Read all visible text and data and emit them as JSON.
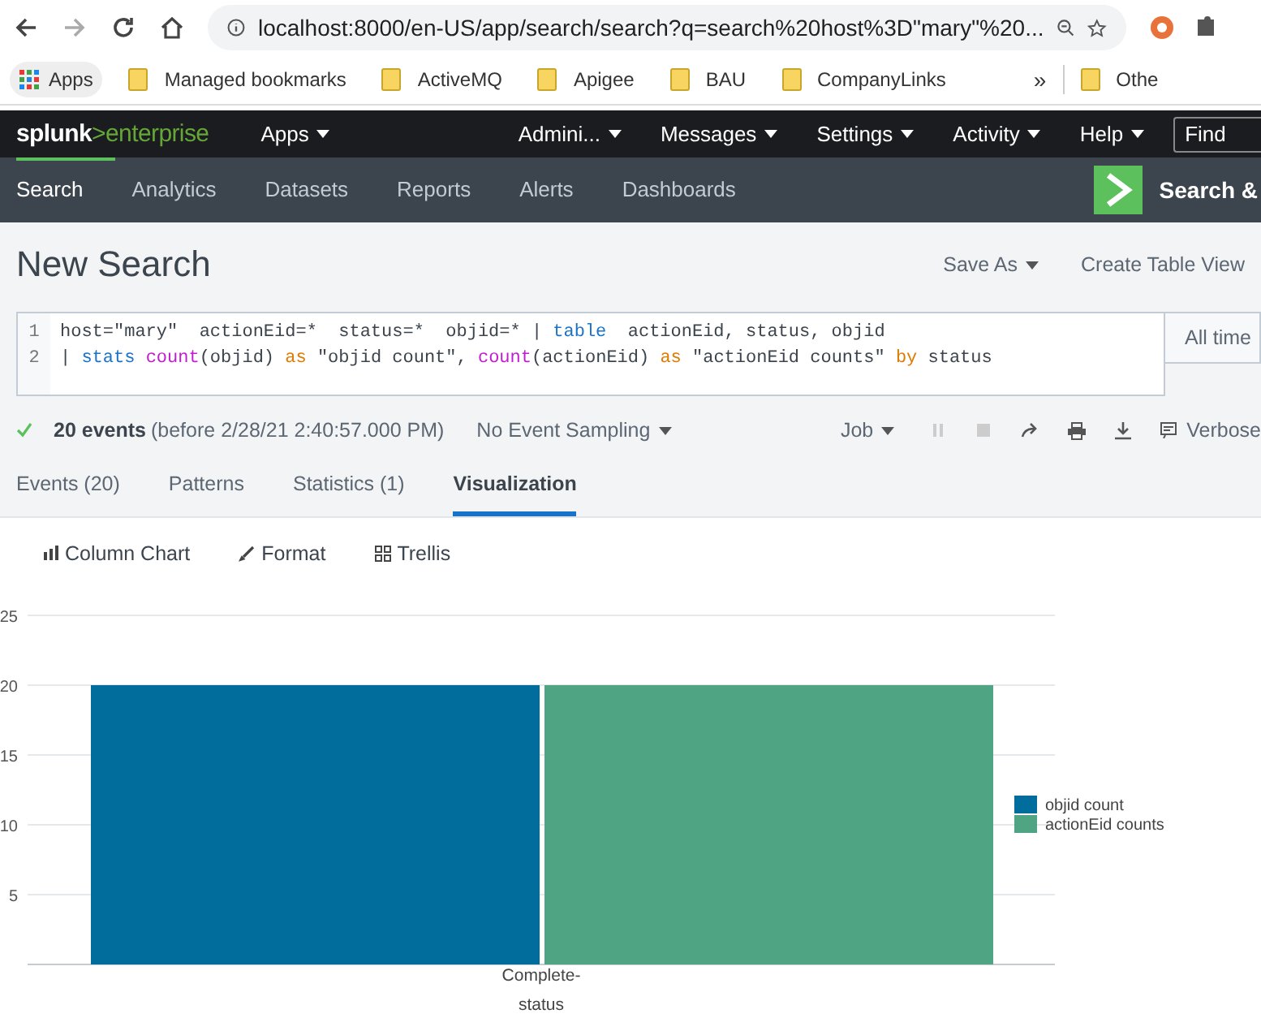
{
  "browser": {
    "url": "localhost:8000/en-US/app/search/search?q=search%20host%3D\"mary\"%20...",
    "apps_label": "Apps",
    "bookmarks": [
      "Managed bookmarks",
      "ActiveMQ",
      "Apigee",
      "BAU",
      "CompanyLinks"
    ],
    "overflow_chevron": "»",
    "other_bookmarks": "Othe"
  },
  "top_nav": {
    "logo_primary": "splunk",
    "logo_secondary": ">enterprise",
    "items": [
      {
        "label": "Apps",
        "kind": "menu"
      },
      {
        "label": "Admini...",
        "kind": "user"
      },
      {
        "label": "Messages",
        "kind": "menu"
      },
      {
        "label": "Settings",
        "kind": "menu"
      },
      {
        "label": "Activity",
        "kind": "menu"
      },
      {
        "label": "Help",
        "kind": "menu"
      }
    ],
    "find_placeholder": "Find"
  },
  "app_nav": {
    "items": [
      {
        "label": "Search",
        "selected": true
      },
      {
        "label": "Analytics",
        "selected": false
      },
      {
        "label": "Datasets",
        "selected": false
      },
      {
        "label": "Reports",
        "selected": false
      },
      {
        "label": "Alerts",
        "selected": false
      },
      {
        "label": "Dashboards",
        "selected": false
      }
    ],
    "app_title": "Search &"
  },
  "header": {
    "title": "New Search",
    "actions": [
      {
        "label": "Save As",
        "dropdown": true
      },
      {
        "label": "Create Table View",
        "dropdown": false
      }
    ]
  },
  "query": {
    "lines": [
      {
        "number": "1",
        "tokens": [
          {
            "text": "host=\"mary\"  actionEid=*  status=*  objid=* | ",
            "kind": "plain"
          },
          {
            "text": "table",
            "kind": "command"
          },
          {
            "text": "  actionEid, status, objid",
            "kind": "plain"
          }
        ]
      },
      {
        "number": "2",
        "tokens": [
          {
            "text": "| ",
            "kind": "plain"
          },
          {
            "text": "stats ",
            "kind": "command"
          },
          {
            "text": "count",
            "kind": "function"
          },
          {
            "text": "(objid) ",
            "kind": "plain"
          },
          {
            "text": "as",
            "kind": "keyword"
          },
          {
            "text": " \"objid count\", ",
            "kind": "plain"
          },
          {
            "text": "count",
            "kind": "function"
          },
          {
            "text": "(actionEid) ",
            "kind": "plain"
          },
          {
            "text": "as",
            "kind": "keyword"
          },
          {
            "text": " \"actionEid counts\" ",
            "kind": "plain"
          },
          {
            "text": "by",
            "kind": "keyword"
          },
          {
            "text": " status",
            "kind": "plain"
          }
        ]
      }
    ],
    "time_range": "All time"
  },
  "job": {
    "event_count": "20 events",
    "event_detail": "(before 2/28/21 2:40:57.000 PM)",
    "sampling": "No Event Sampling",
    "job_label": "Job",
    "mode": "Verbose"
  },
  "result_tabs": [
    {
      "label": "Events (20)",
      "selected": false
    },
    {
      "label": "Patterns",
      "selected": false
    },
    {
      "label": "Statistics (1)",
      "selected": false
    },
    {
      "label": "Visualization",
      "selected": true
    }
  ],
  "visualization": {
    "toolbar": [
      {
        "label": "Column Chart",
        "kind": "chart"
      },
      {
        "label": "Format",
        "kind": "format"
      },
      {
        "label": "Trellis",
        "kind": "trellis"
      }
    ],
    "chart_data": {
      "type": "bar",
      "categories": [
        "Complete-"
      ],
      "xlabel": "status",
      "ylim": [
        0,
        25
      ],
      "grid": true,
      "legend": true,
      "yticks": [
        5,
        10,
        15,
        20,
        25
      ],
      "series": [
        {
          "name": "objid count",
          "color": "#006d9c",
          "values": [
            20
          ]
        },
        {
          "name": "actionEid counts",
          "color": "#4fa484",
          "values": [
            20
          ]
        }
      ]
    }
  }
}
